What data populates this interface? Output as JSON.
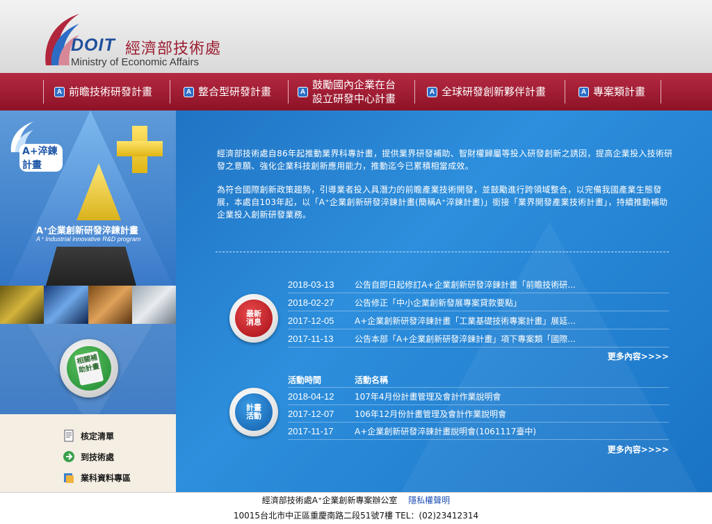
{
  "header": {
    "logo_doit": "DOIT",
    "logo_cn": "經濟部技術處",
    "logo_en": "Ministry of Economic Affairs"
  },
  "nav": {
    "items": [
      {
        "label": "前瞻技術研發計畫"
      },
      {
        "label": "整合型研發計畫"
      },
      {
        "label_line1": "鼓勵國內企業在台",
        "label_line2": "設立研發中心計畫"
      },
      {
        "label": "全球研發創新夥伴計畫"
      },
      {
        "label": "專案類計畫"
      }
    ]
  },
  "left": {
    "badge": "A+淬鍊計畫",
    "program_title": "A⁺企業創新研發淬鍊計畫",
    "program_subtitle": "A⁺ Industrial innovative R&D program",
    "related_label": "相關補助計畫",
    "menu": [
      {
        "label": "核定清單"
      },
      {
        "label": "到技術處"
      },
      {
        "label": "業科資料專區"
      }
    ]
  },
  "intro": {
    "p1": "經濟部技術處自86年起推動業界科專計畫，提供業界研發補助、智財權歸屬等投入研發創新之誘因，提高企業投入技術研發之意願、強化企業科技創新應用能力，推動迄今已累積相當成效。",
    "p2": "為符合國際創新政策趨勢，引導業者投入具潛力的前瞻產業技術開發，並鼓勵進行跨領域整合，以完備我國產業生態發展，本處自103年起，以「A⁺企業創新研發淬鍊計畫(簡稱A⁺淬鍊計畫)」銜接「業界開發產業技術計畫」，持續推動補助企業投入創新研發業務。"
  },
  "news": {
    "icon_label": "最新消息",
    "rows": [
      {
        "date": "2018-03-13",
        "title": "公告自即日起修訂A+企業創新研發淬鍊計畫「前瞻技術研..."
      },
      {
        "date": "2018-02-27",
        "title": "公告修正「中小企業創新發展專案貸款要點」"
      },
      {
        "date": "2017-12-05",
        "title": "A+企業創新研發淬鍊計畫「工業基礎技術專案計畫」展延..."
      },
      {
        "date": "2017-11-13",
        "title": "公告本部「A+企業創新研發淬鍊計畫」項下專案類「國際..."
      }
    ],
    "more": "更多內容>>>>"
  },
  "events": {
    "icon_label": "計畫活動",
    "head_time": "活動時間",
    "head_name": "活動名稱",
    "rows": [
      {
        "date": "2018-04-12",
        "title": "107年4月份計畫管理及會計作業說明會"
      },
      {
        "date": "2017-12-07",
        "title": "106年12月份計畫管理及會計作業說明會"
      },
      {
        "date": "2017-11-17",
        "title": "A+企業創新研發淬鍊計畫說明會(1061117臺中)"
      }
    ],
    "more": "更多內容>>>>"
  },
  "footer": {
    "office": "經濟部技術處A⁺企業創新專案辦公室",
    "privacy": "隱私權聲明",
    "address": "10015台北市中正區重慶南路二段51號7樓 TEL：(02)23412314"
  },
  "colors": {
    "nav_bg": "#a3203a",
    "main_bg": "#1f78cc",
    "footer_link": "#1c4fb6"
  }
}
